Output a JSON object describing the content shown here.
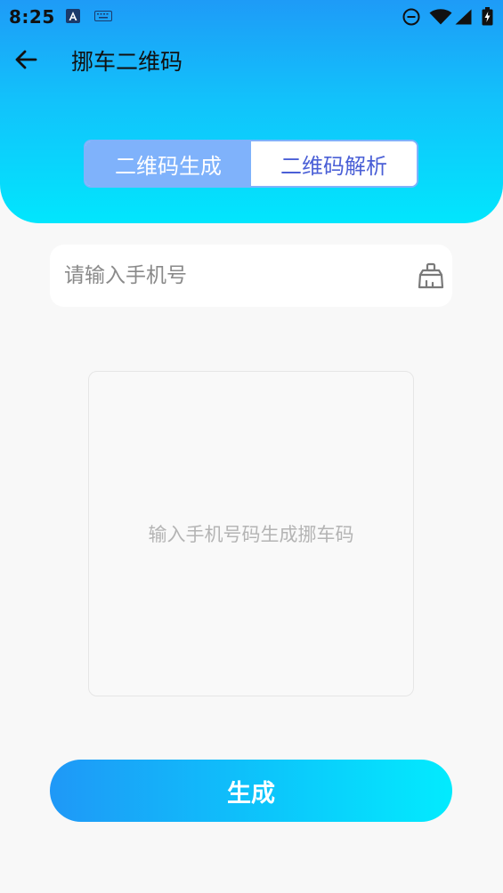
{
  "status_bar": {
    "time": "8:25",
    "icons": [
      "a-notification-icon",
      "keyboard-icon",
      "do-not-disturb-icon",
      "wifi-icon",
      "cell-signal-icon",
      "battery-charging-icon"
    ]
  },
  "toolbar": {
    "title": "挪车二维码",
    "back_icon": "arrow-left-icon"
  },
  "tabs": [
    {
      "label": "二维码生成",
      "active": true
    },
    {
      "label": "二维码解析",
      "active": false
    }
  ],
  "phone_input": {
    "value": "",
    "placeholder": "请输入手机号",
    "clear_icon": "broom-icon"
  },
  "qr_area": {
    "hint": "输入手机号码生成挪车码"
  },
  "generate_button": {
    "label": "生成"
  },
  "colors": {
    "header_top": "#1e9bf7",
    "header_bottom": "#01e6fd",
    "tab_active_bg": "#7fb2fb",
    "tab_inactive_text": "#4a5fd6",
    "button_start": "#1f98f7",
    "button_end": "#02ebfe",
    "background": "#f8f8f8"
  }
}
